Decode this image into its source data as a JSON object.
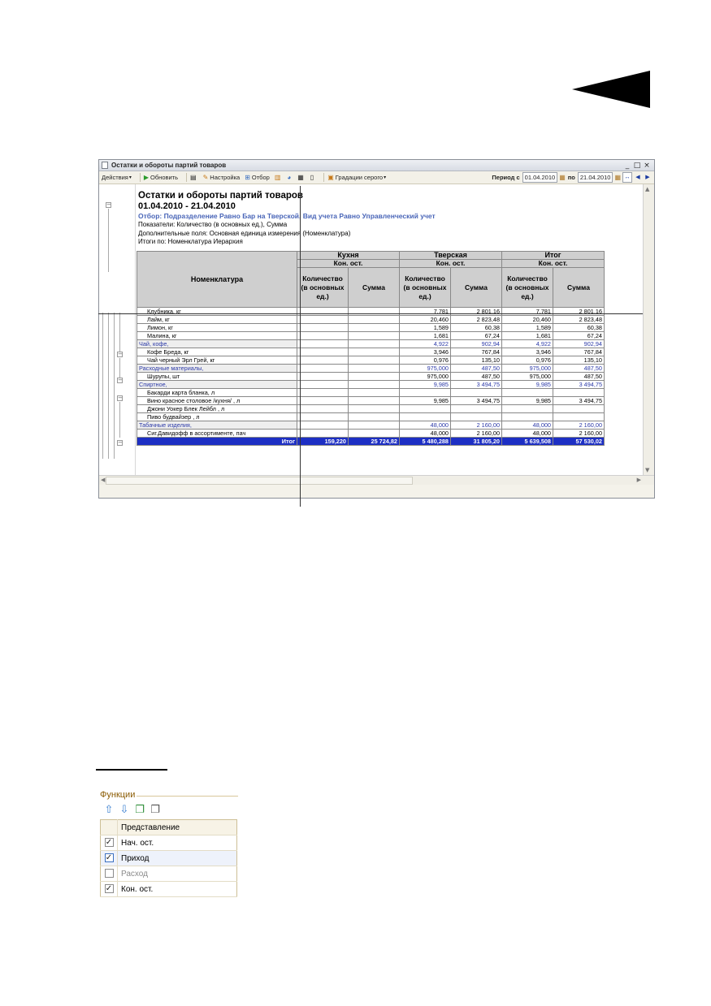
{
  "window": {
    "title": "Остатки и обороты партий товаров",
    "btn_minimize": "_",
    "btn_restore": "□",
    "btn_close": "×"
  },
  "toolbar": {
    "actions": "Действия",
    "refresh": "Обновить",
    "settings": "Настройка",
    "filter": "Отбор",
    "gradation": "Градации серого",
    "period_from_label": "Период с",
    "period_from": "01.04.2010",
    "period_to_label": "по",
    "period_to": "21.04.2010"
  },
  "report": {
    "title": "Остатки и обороты партий товаров",
    "period": "01.04.2010 - 21.04.2010",
    "filter": "Отбор: Подразделение Равно Бар на Тверской, Вид учета Равно Управленческий учет",
    "indicators": "Показатели: Количество (в основных ед.), Сумма",
    "extra_fields": "Дополнительные поля: Основная единица измерения (Номенклатура)",
    "totals_by": "Итоги по: Номенклатура Иерархия"
  },
  "table": {
    "col_nomenclature": "Номенклатура",
    "groups": [
      "Кухня",
      "Тверская",
      "Итог"
    ],
    "sub": "Кон. ост.",
    "qty": "Количество (в основных ед.)",
    "sum": "Сумма",
    "rows": [
      {
        "name": "Клубника, кг",
        "type": "item",
        "c1": "",
        "c2": "",
        "c3": "7,781",
        "c4": "2 801,16",
        "c5": "7,781",
        "c6": "2 801,16"
      },
      {
        "name": "Лайм, кг",
        "type": "item",
        "c1": "",
        "c2": "",
        "c3": "20,460",
        "c4": "2 823,48",
        "c5": "20,460",
        "c6": "2 823,48"
      },
      {
        "name": "Лимон, кг",
        "type": "item",
        "c1": "",
        "c2": "",
        "c3": "1,589",
        "c4": "60,38",
        "c5": "1,589",
        "c6": "60,38"
      },
      {
        "name": "Малина, кг",
        "type": "item",
        "c1": "",
        "c2": "",
        "c3": "1,681",
        "c4": "67,24",
        "c5": "1,681",
        "c6": "67,24"
      },
      {
        "name": "Чай, кофе,",
        "type": "group",
        "c1": "",
        "c2": "",
        "c3": "4,922",
        "c4": "902,94",
        "c5": "4,922",
        "c6": "902,94"
      },
      {
        "name": "Кофе Бреда, кг",
        "type": "item",
        "c1": "",
        "c2": "",
        "c3": "3,946",
        "c4": "767,84",
        "c5": "3,946",
        "c6": "767,84"
      },
      {
        "name": "Чай черный Эрл Грей, кг",
        "type": "item",
        "c1": "",
        "c2": "",
        "c3": "0,976",
        "c4": "135,10",
        "c5": "0,976",
        "c6": "135,10"
      },
      {
        "name": "Расходные материалы,",
        "type": "group",
        "c1": "",
        "c2": "",
        "c3": "975,000",
        "c4": "487,50",
        "c5": "975,000",
        "c6": "487,50"
      },
      {
        "name": "Шурупы, шт",
        "type": "item",
        "c1": "",
        "c2": "",
        "c3": "975,000",
        "c4": "487,50",
        "c5": "975,000",
        "c6": "487,50"
      },
      {
        "name": "Спиртное,",
        "type": "group",
        "c1": "",
        "c2": "",
        "c3": "9,985",
        "c4": "3 494,75",
        "c5": "9,985",
        "c6": "3 494,75"
      },
      {
        "name": "Бакарди карта бланка, л",
        "type": "item",
        "c1": "",
        "c2": "",
        "c3": "",
        "c4": "",
        "c5": "",
        "c6": ""
      },
      {
        "name": "Вино красное столовое /кухня/ , л",
        "type": "item",
        "c1": "",
        "c2": "",
        "c3": "9,985",
        "c4": "3 494,75",
        "c5": "9,985",
        "c6": "3 494,75"
      },
      {
        "name": "Джони Уокер Блек Лейбл , л",
        "type": "item",
        "c1": "",
        "c2": "",
        "c3": "",
        "c4": "",
        "c5": "",
        "c6": ""
      },
      {
        "name": "Пиво будвайзер , л",
        "type": "item",
        "c1": "",
        "c2": "",
        "c3": "",
        "c4": "",
        "c5": "",
        "c6": ""
      },
      {
        "name": "Табачные изделия,",
        "type": "group",
        "c1": "",
        "c2": "",
        "c3": "48,000",
        "c4": "2 160,00",
        "c5": "48,000",
        "c6": "2 160,00"
      },
      {
        "name": "Сиг.Давидофф в ассортименте, пач",
        "type": "item",
        "c1": "",
        "c2": "",
        "c3": "48,000",
        "c4": "2 160,00",
        "c5": "48,000",
        "c6": "2 160,00"
      }
    ],
    "total": {
      "name": "Итог",
      "c1": "159,220",
      "c2": "25 724,82",
      "c3": "5 480,288",
      "c4": "31 805,20",
      "c5": "5 639,508",
      "c6": "57 530,02"
    }
  },
  "functions_panel": {
    "title": "Функции",
    "column_header": "Представление",
    "items": [
      {
        "label": "Нач. ост.",
        "checked": true
      },
      {
        "label": "Приход",
        "checked": true
      },
      {
        "label": "Расход",
        "checked": false
      },
      {
        "label": "Кон. ост.",
        "checked": true
      }
    ]
  }
}
